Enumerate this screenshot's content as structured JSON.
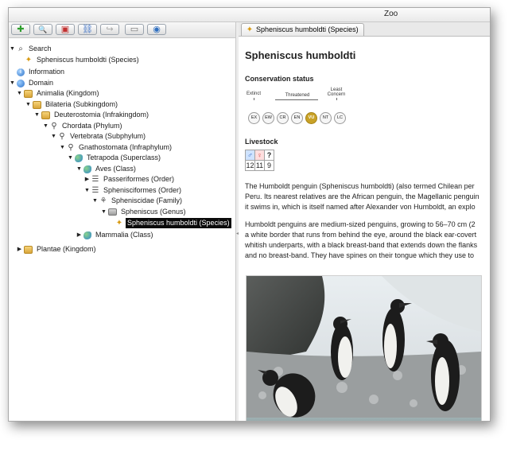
{
  "window": {
    "title": "Zoo"
  },
  "toolbar": {
    "buttons": [
      {
        "name": "add",
        "glyph": "✚",
        "color": "#2e9e2e"
      },
      {
        "name": "search",
        "glyph": "🔍",
        "color": "#333333"
      },
      {
        "name": "bookmark",
        "glyph": "▣",
        "color": "#c23030"
      },
      {
        "name": "link",
        "glyph": "⛓",
        "color": "#3a6fc4"
      },
      {
        "name": "redo",
        "glyph": "↪",
        "color": "#a8a8a8"
      },
      {
        "name": "folder",
        "glyph": "▭",
        "color": "#777777"
      },
      {
        "name": "eye",
        "glyph": "◉",
        "color": "#2f6fc0"
      }
    ]
  },
  "tree": {
    "search": "Search",
    "search_result": "Spheniscus humboldti (Species)",
    "information": "Information",
    "domain": "Domain",
    "animalia": "Animalia (Kingdom)",
    "bilateria": "Bilateria (Subkingdom)",
    "deuterostomia": "Deuterostomia (Infrakingdom)",
    "chordata": "Chordata (Phylum)",
    "vertebrata": "Vertebrata (Subphylum)",
    "gnathostomata": "Gnathostomata (Infraphylum)",
    "tetrapoda": "Tetrapoda (Superclass)",
    "aves": "Aves (Class)",
    "passeriformes": "Passeriformes (Order)",
    "sphenisciformes": "Sphenisciformes (Order)",
    "spheniscidae": "Spheniscidae (Family)",
    "spheniscus": "Spheniscus (Genus)",
    "humboldti": "Spheniscus humboldti (Species)",
    "mammalia": "Mammalia (Class)",
    "plantae": "Plantae (Kingdom)"
  },
  "tab": {
    "label": "Spheniscus humboldti (Species)"
  },
  "article": {
    "title": "Spheniscus humboldti",
    "conservation_heading": "Conservation status",
    "extinct_label": "Extinct",
    "threatened_label": "Threatened",
    "least_label": "Least",
    "concern_label": "Concern",
    "statuses": [
      "EX",
      "EW",
      "CR",
      "EN",
      "VU",
      "NT",
      "LC"
    ],
    "active_status": "VU",
    "livestock_heading": "Livestock",
    "livestock": {
      "male_icon": "♂",
      "female_icon": "♀",
      "unknown_icon": "?",
      "male": "12",
      "female": "11",
      "unknown": "9"
    },
    "paragraph1_lines": [
      "The Humboldt penguin (Spheniscus humboldti) (also termed Chilean per",
      "Peru. Its nearest relatives are the African penguin, the Magellanic penguin",
      "it swims in, which is itself named after Alexander von Humboldt, an explo"
    ],
    "paragraph2_lines": [
      "Humboldt penguins are medium-sized penguins, growing to 56–70 cm (2",
      "a white border that runs from behind the eye, around the black ear-covert",
      "whitish underparts, with a black breast-band that extends down the flanks",
      "and no breast-band. They have spines on their tongue which they use to"
    ]
  },
  "colors": {
    "selection": "#0a0a0a",
    "vu_active": "#c9a227"
  }
}
